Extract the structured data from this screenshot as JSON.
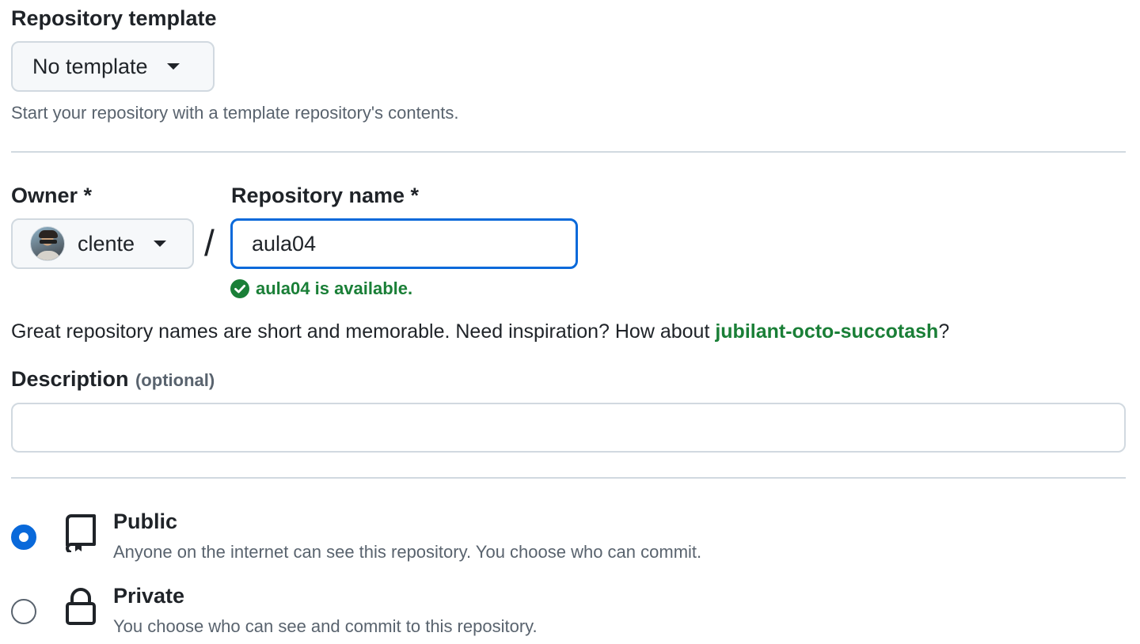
{
  "template_section": {
    "label": "Repository template",
    "select_value": "No template",
    "hint": "Start your repository with a template repository's contents."
  },
  "owner": {
    "label": "Owner *",
    "value": "clente"
  },
  "separator": "/",
  "repo_name": {
    "label": "Repository name *",
    "value": "aula04",
    "availability": "aula04 is available."
  },
  "inspiration": {
    "prefix": "Great repository names are short and memorable. Need inspiration? How about ",
    "suggestion": "jubilant-octo-succotash",
    "suffix": "?"
  },
  "description": {
    "label": "Description",
    "optional": "(optional)",
    "value": ""
  },
  "visibility": [
    {
      "title": "Public",
      "desc": "Anyone on the internet can see this repository. You choose who can commit.",
      "selected": true,
      "icon": "repo-icon"
    },
    {
      "title": "Private",
      "desc": "You choose who can see and commit to this repository.",
      "selected": false,
      "icon": "lock-icon"
    }
  ],
  "colors": {
    "accent": "#0969da",
    "success": "#1a7f37",
    "border": "#d1d9e0",
    "muted": "#59636e"
  }
}
